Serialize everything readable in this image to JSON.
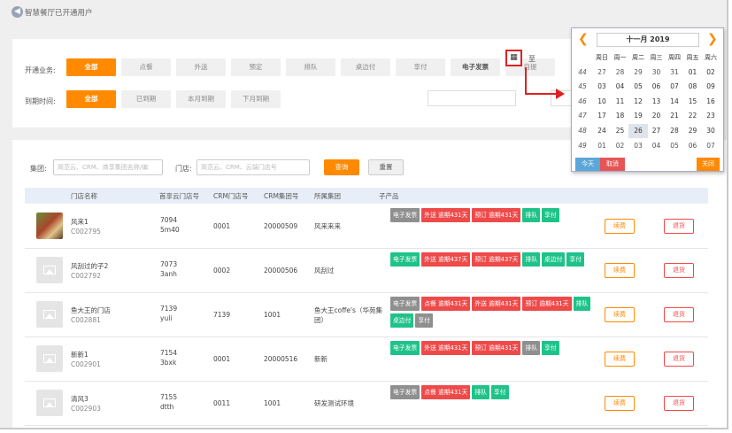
{
  "header": {
    "title": "智慧餐厅已开通用户",
    "back_icon": "◀"
  },
  "filters": {
    "business_label": "开通业务:",
    "business_options": [
      "全部",
      "点餐",
      "外送",
      "预定",
      "排队",
      "桌边付",
      "享付",
      "电子发票",
      "自提"
    ],
    "business_selected": "全部",
    "expire_label": "到期时间:",
    "expire_options": [
      "全部",
      "已到期",
      "本月到期",
      "下月到期"
    ],
    "expire_selected": "全部",
    "cal_icon": "▦",
    "to_label": "至"
  },
  "search": {
    "group_label": "集团:",
    "group_placeholder": "简范云、CRM、商享集团名称/编",
    "store_label": "门店:",
    "store_placeholder": "简范云、CRM、云端门店号",
    "query_label": "查询",
    "reset_label": "重置"
  },
  "table": {
    "headers": [
      "门店名称",
      "首享云门店号",
      "CRM门店号",
      "CRM集团号",
      "所属集团",
      "子产品"
    ],
    "rows": [
      {
        "name": "风来1",
        "code": "C002795",
        "cloud_no": "7094",
        "cloud_sub": "5m40",
        "crm_store": "0001",
        "crm_group": "20000509",
        "group": "风来来来",
        "tags": [
          {
            "t": "电子发票",
            "c": "gray"
          },
          {
            "t": "外送  逾期431天",
            "c": "red"
          },
          {
            "t": "预订  逾期431天",
            "c": "red"
          },
          {
            "t": "排队",
            "c": "green"
          },
          {
            "t": "享付",
            "c": "green"
          }
        ]
      },
      {
        "name": "风刮过的子2",
        "code": "C002792",
        "cloud_no": "7073",
        "cloud_sub": "3anh",
        "crm_store": "0002",
        "crm_group": "20000506",
        "group": "风刮过",
        "tags": [
          {
            "t": "电子发票",
            "c": "green"
          },
          {
            "t": "外送  逾期437天",
            "c": "red"
          },
          {
            "t": "预订  逾期437天",
            "c": "red"
          },
          {
            "t": "排队",
            "c": "green"
          },
          {
            "t": "桌边付",
            "c": "green"
          },
          {
            "t": "享付",
            "c": "green"
          }
        ]
      },
      {
        "name": "鱼大王的门店",
        "code": "C002881",
        "cloud_no": "7139",
        "cloud_sub": "yuli",
        "crm_store": "7139",
        "crm_group": "1001",
        "group": "鱼大王coffe's（华苑集团）",
        "tags": [
          {
            "t": "电子发票",
            "c": "gray"
          },
          {
            "t": "点餐  逾期431天",
            "c": "red"
          },
          {
            "t": "外送  逾期431天",
            "c": "red"
          },
          {
            "t": "预订  逾期431天",
            "c": "red"
          },
          {
            "t": "排队",
            "c": "green"
          },
          {
            "t": "桌边付",
            "c": "green"
          },
          {
            "t": "享付",
            "c": "gray"
          }
        ]
      },
      {
        "name": "新新1",
        "code": "C002901",
        "cloud_no": "7154",
        "cloud_sub": "3bxk",
        "crm_store": "0001",
        "crm_group": "20000516",
        "group": "新新",
        "tags": [
          {
            "t": "电子发票",
            "c": "green"
          },
          {
            "t": "外送  逾期431天",
            "c": "red"
          },
          {
            "t": "预订  逾期431天",
            "c": "red"
          },
          {
            "t": "排队",
            "c": "gray"
          },
          {
            "t": "享付",
            "c": "green"
          }
        ]
      },
      {
        "name": "清风3",
        "code": "C002903",
        "cloud_no": "7155",
        "cloud_sub": "dtth",
        "crm_store": "0011",
        "crm_group": "1001",
        "group": "研发测试环境",
        "tags": [
          {
            "t": "电子发票",
            "c": "gray"
          },
          {
            "t": "点餐  逾期431天",
            "c": "red"
          },
          {
            "t": "排队",
            "c": "green"
          },
          {
            "t": "享付",
            "c": "green"
          }
        ]
      }
    ],
    "edit_label": "续费",
    "refund_label": "退货"
  },
  "calendar": {
    "prev_icon": "❮",
    "next_icon": "❯",
    "title": "十一月  2019",
    "dow": [
      "周日",
      "周一",
      "周二",
      "周三",
      "周四",
      "周五",
      "周六"
    ],
    "weeks": [
      {
        "wk": "44",
        "days": [
          "27",
          "28",
          "29",
          "30",
          "31",
          "01",
          "02"
        ]
      },
      {
        "wk": "45",
        "days": [
          "03",
          "04",
          "05",
          "06",
          "07",
          "08",
          "09"
        ]
      },
      {
        "wk": "46",
        "days": [
          "10",
          "11",
          "12",
          "13",
          "14",
          "15",
          "16"
        ]
      },
      {
        "wk": "47",
        "days": [
          "17",
          "18",
          "19",
          "20",
          "21",
          "22",
          "23"
        ]
      },
      {
        "wk": "48",
        "days": [
          "24",
          "25",
          "26",
          "27",
          "28",
          "29",
          "30"
        ]
      },
      {
        "wk": "49",
        "days": [
          "01",
          "02",
          "03",
          "04",
          "05",
          "06",
          "07"
        ]
      }
    ],
    "today_day": "26",
    "today_label": "今天",
    "cancel_label": "取消",
    "close_label": "关闭"
  }
}
